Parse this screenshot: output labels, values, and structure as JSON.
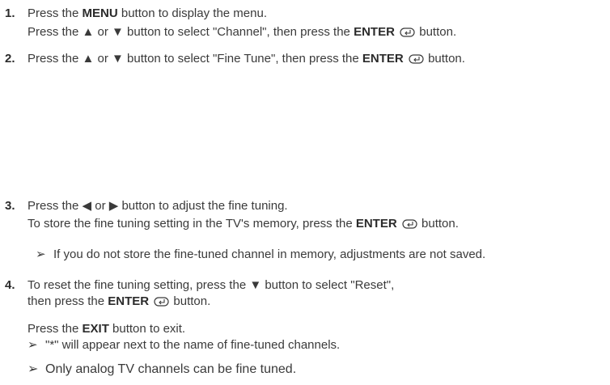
{
  "steps": [
    {
      "number": "1.",
      "lines": [
        {
          "pre": "Press the ",
          "key": "MENU",
          "post": " button to display the menu."
        },
        {
          "pre": "Press the ▲ or ▼ button to select \"Channel\", then press the ",
          "key": "ENTER",
          "icon": "enter-icon",
          "post": " button."
        }
      ]
    },
    {
      "number": "2.",
      "lines": [
        {
          "pre": "Press the ▲ or ▼ button to select \"Fine Tune\", then press the ",
          "key": "ENTER",
          "icon": "enter-icon",
          "post": " button."
        }
      ]
    },
    {
      "number": "3.",
      "lines": [
        {
          "pre": "Press the ◀ or ▶ button to adjust the fine tuning."
        },
        {
          "pre": "To store the fine tuning setting in the TV's memory, press the ",
          "key": "ENTER",
          "icon": "enter-icon",
          "post": " button."
        }
      ],
      "notes": [
        "If you do not store the fine-tuned channel in memory, adjustments are not saved."
      ]
    },
    {
      "number": "4.",
      "lines": [
        {
          "pre": "To reset the fine tuning setting, press the ▼ button to select \"Reset\","
        },
        {
          "pre": "then press  the ",
          "key": "ENTER",
          "icon": "enter-icon",
          "post": " button."
        }
      ],
      "extra": {
        "pre": "Press the ",
        "key": "EXIT",
        "post": " button to exit."
      },
      "notes": [
        "\"*\" will appear next to the name of fine-tuned channels.",
        "Only analog TV channels can be fine tuned."
      ]
    }
  ],
  "note_arrow": "➢"
}
